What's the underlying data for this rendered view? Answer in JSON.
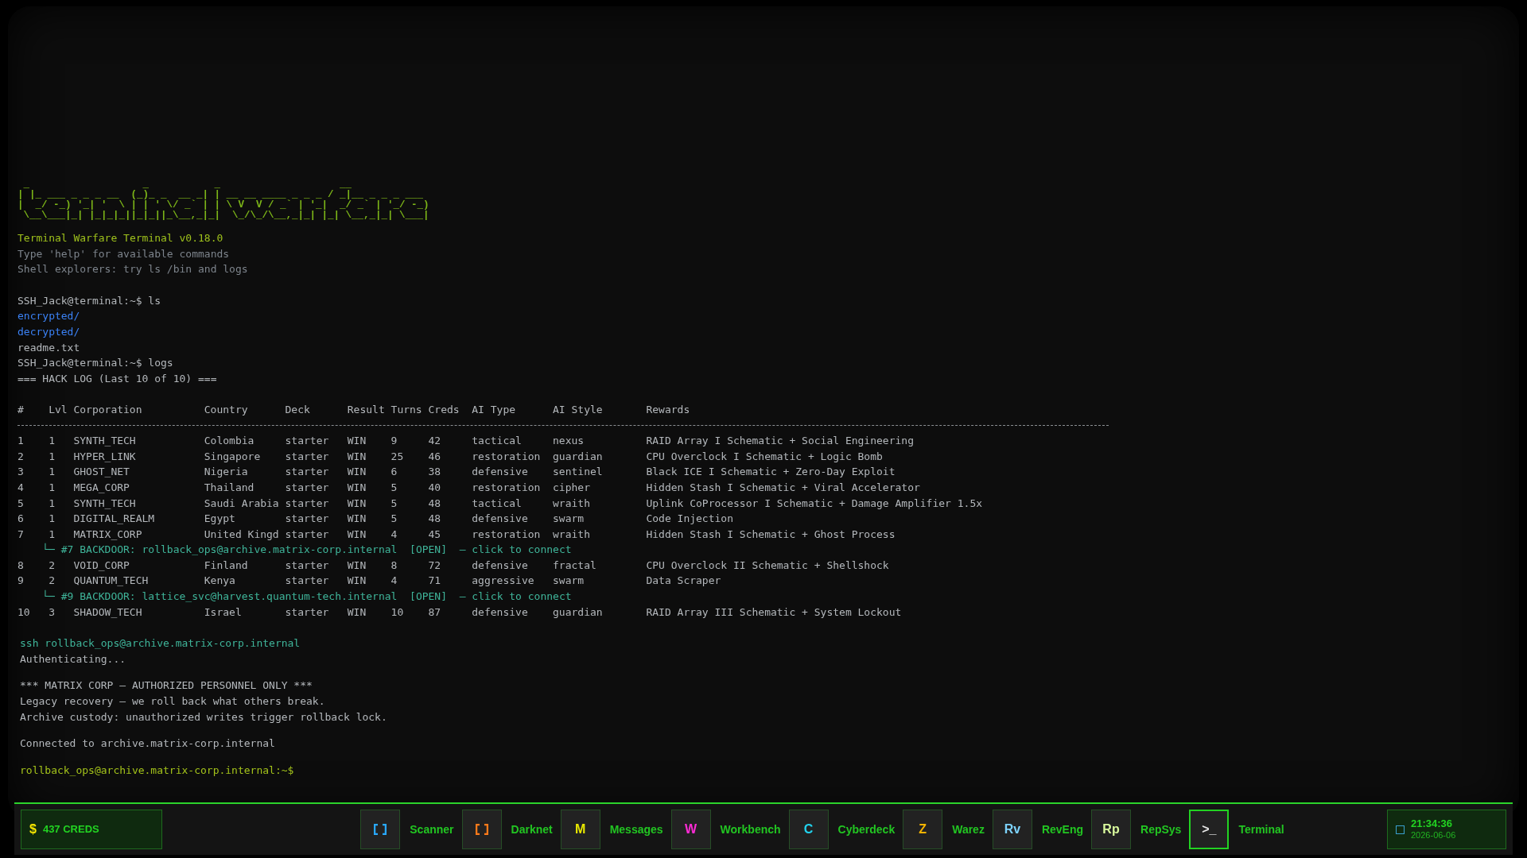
{
  "logo": [
    " _                   _           _                    __              ",
    "| |_ ___ _ _ _ __  (_)_ _  __ _| | __ __ ____ _ _ _ / _|__ _ _ _ ___ ",
    "|  _/ -_) '_| '  \\ | | ' \\/ _` | | \\ V  V / _` | '_|  _/ _` | '_/ -_)",
    " \\__\\___|_| |_|_|_||_|_||_\\__,_|_|  \\_/\\_/\\__,_|_| |_| \\__,_|_| \\___|"
  ],
  "intro": [
    {
      "kind": "title",
      "text": "Terminal Warfare Terminal v0.18.0"
    },
    {
      "kind": "dim",
      "text": "Type 'help' for available commands"
    },
    {
      "kind": "dim",
      "text": "Shell explorers: try ls /bin and logs"
    }
  ],
  "session": [
    {
      "kind": "plain",
      "text": "SSH_Jack@terminal:~$ ls"
    },
    {
      "kind": "dir",
      "text": "encrypted/"
    },
    {
      "kind": "dir",
      "text": "decrypted/"
    },
    {
      "kind": "plain",
      "text": "readme.txt"
    },
    {
      "kind": "plain",
      "text": "SSH_Jack@terminal:~$ logs"
    },
    {
      "kind": "plain",
      "text": "=== HACK LOG (Last 10 of 10) ==="
    }
  ],
  "hack_log": {
    "columns": [
      "#",
      "Lvl",
      "Corporation",
      "Country",
      "Deck",
      "Result",
      "Turns",
      "Creds",
      "AI Type",
      "AI Style",
      "Rewards"
    ],
    "rows": [
      {
        "kind": "entry",
        "cells": [
          "1",
          "1",
          "SYNTH_TECH",
          "Colombia",
          "starter",
          "WIN",
          "9",
          "42",
          "tactical",
          "nexus",
          "RAID Array I Schematic + Social Engineering"
        ]
      },
      {
        "kind": "entry",
        "cells": [
          "2",
          "1",
          "HYPER_LINK",
          "Singapore",
          "starter",
          "WIN",
          "25",
          "46",
          "restoration",
          "guardian",
          "CPU Overclock I Schematic + Logic Bomb"
        ]
      },
      {
        "kind": "entry",
        "cells": [
          "3",
          "1",
          "GHOST_NET",
          "Nigeria",
          "starter",
          "WIN",
          "6",
          "38",
          "defensive",
          "sentinel",
          "Black ICE I Schematic + Zero-Day Exploit"
        ]
      },
      {
        "kind": "entry",
        "cells": [
          "4",
          "1",
          "MEGA_CORP",
          "Thailand",
          "starter",
          "WIN",
          "5",
          "40",
          "restoration",
          "cipher",
          "Hidden Stash I Schematic + Viral Accelerator"
        ]
      },
      {
        "kind": "entry",
        "cells": [
          "5",
          "1",
          "SYNTH_TECH",
          "Saudi Arabia",
          "starter",
          "WIN",
          "5",
          "48",
          "tactical",
          "wraith",
          "Uplink CoProcessor I Schematic + Damage Amplifier 1.5x"
        ]
      },
      {
        "kind": "entry",
        "cells": [
          "6",
          "1",
          "DIGITAL_REALM",
          "Egypt",
          "starter",
          "WIN",
          "5",
          "48",
          "defensive",
          "swarm",
          "Code Injection"
        ]
      },
      {
        "kind": "entry",
        "cells": [
          "7",
          "1",
          "MATRIX_CORP",
          "United Kingd",
          "starter",
          "WIN",
          "4",
          "45",
          "restoration",
          "wraith",
          "Hidden Stash I Schematic + Ghost Process"
        ]
      },
      {
        "kind": "backdoor",
        "label": "└─ #7 BACKDOOR:",
        "address": "rollback_ops@archive.matrix-corp.internal",
        "status": "[OPEN]",
        "link": "— click to connect"
      },
      {
        "kind": "entry",
        "cells": [
          "8",
          "2",
          "VOID_CORP",
          "Finland",
          "starter",
          "WIN",
          "8",
          "72",
          "defensive",
          "fractal",
          "CPU Overclock II Schematic + Shellshock"
        ]
      },
      {
        "kind": "entry",
        "cells": [
          "9",
          "2",
          "QUANTUM_TECH",
          "Kenya",
          "starter",
          "WIN",
          "4",
          "71",
          "aggressive",
          "swarm",
          "Data Scraper"
        ]
      },
      {
        "kind": "backdoor",
        "label": "└─ #9 BACKDOOR:",
        "address": "lattice_svc@harvest.quantum-tech.internal",
        "status": "[OPEN]",
        "link": "— click to connect"
      },
      {
        "kind": "entry",
        "cells": [
          "10",
          "3",
          "SHADOW_TECH",
          "Israel",
          "starter",
          "WIN",
          "10",
          "87",
          "defensive",
          "guardian",
          "RAID Array III Schematic + System Lockout"
        ]
      }
    ]
  },
  "remote": [
    [
      {
        "kind": "teal",
        "text": "ssh rollback_ops@archive.matrix-corp.internal"
      },
      {
        "kind": "plain",
        "text": "Authenticating..."
      }
    ],
    [
      {
        "kind": "plain",
        "text": "*** MATRIX CORP — AUTHORIZED PERSONNEL ONLY ***"
      },
      {
        "kind": "plain",
        "text": "Legacy recovery — we roll back what others break."
      },
      {
        "kind": "plain",
        "text": "Archive custody: unauthorized writes trigger rollback lock."
      }
    ],
    [
      {
        "kind": "plain",
        "text": "Connected to archive.matrix-corp.internal"
      }
    ],
    [
      {
        "kind": "prompt",
        "text": "rollback_ops@archive.matrix-corp.internal:~$"
      }
    ]
  ],
  "taskbar": {
    "credits": {
      "symbol": "$",
      "text": "437 CREDS"
    },
    "apps": [
      {
        "kind": "frame",
        "label": "Scanner",
        "color": "#29a8ff",
        "selected": false
      },
      {
        "kind": "frame",
        "label": "Darknet",
        "color": "#ff7a1a",
        "selected": false
      },
      {
        "kind": "glyph",
        "glyph": "M",
        "label": "Messages",
        "color": "#e8e800",
        "selected": false
      },
      {
        "kind": "glyph",
        "glyph": "W",
        "label": "Workbench",
        "color": "#ff2bd6",
        "selected": false
      },
      {
        "kind": "glyph",
        "glyph": "C",
        "label": "Cyberdeck",
        "color": "#22d3ee",
        "selected": false
      },
      {
        "kind": "glyph",
        "glyph": "Z",
        "label": "Warez",
        "color": "#f5b300",
        "selected": false
      },
      {
        "kind": "glyph",
        "glyph": "Rv",
        "label": "RevEng",
        "color": "#7dd3fc",
        "selected": false
      },
      {
        "kind": "glyph",
        "glyph": "Rp",
        "label": "RepSys",
        "color": "#d9f99d",
        "selected": false
      },
      {
        "kind": "glyph",
        "glyph": ">_",
        "label": "Terminal",
        "color": "#e5e5e5",
        "selected": true
      }
    ],
    "clock": {
      "time": "21:34:36",
      "date": "2026-06-06"
    }
  }
}
